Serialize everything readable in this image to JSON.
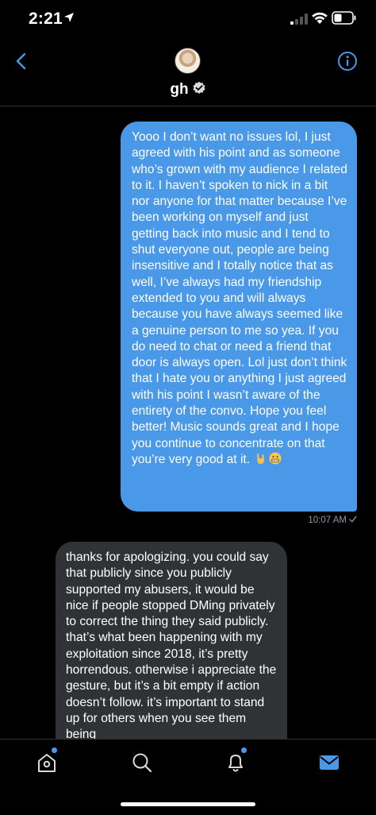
{
  "status_bar": {
    "time": "2:21"
  },
  "header": {
    "display_name": "gh"
  },
  "messages": {
    "sent": {
      "text": "Yooo I don’t want no issues lol, I just agreed with his point and as someone who’s grown with my audience I related to it.  I haven’t spoken to nick in a bit nor anyone for that matter because I’ve been working on myself and just getting back into music and I tend to shut everyone out, people are being insensitive and I totally notice that as well, I’ve always had my friendship extended to you and will always because you have always seemed like a genuine person to me so yea.  If you do need to chat or need a friend that door is always open.  Lol just don’t think that I hate you or anything I just agreed with his point I wasn’t aware of the entirety of the convo.  Hope you feel better! Music sounds great and I hope you continue to concentrate on that you’re very good at it.",
      "emojis": [
        "rock-hand-emoji",
        "grimace-emoji"
      ],
      "timestamp": "10:07 AM"
    },
    "received": {
      "text": "thanks for apologizing. you could say that publicly since you publicly supported my abusers, it would be nice if people stopped DMing privately to correct the thing they said publicly. that’s what been happening with my exploitation since 2018, it’s pretty horrendous. otherwise i appreciate the gesture, but it’s a bit empty if action doesn’t follow. it’s important to stand up for others when you see them being"
    }
  },
  "tabs": [
    "home-icon",
    "search-icon",
    "notifications-icon",
    "messages-icon"
  ],
  "colors": {
    "accent": "#4a99e9",
    "received_bubble": "#2f3336",
    "meta": "#8b98a5"
  }
}
